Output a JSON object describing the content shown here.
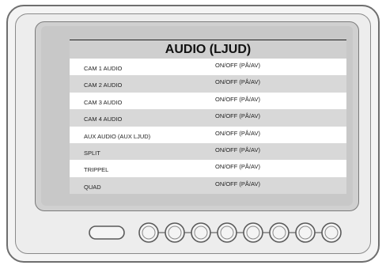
{
  "menu": {
    "title": "AUDIO (LJUD)",
    "rows": [
      {
        "label": "CAM 1 AUDIO",
        "value": "ON/OFF (PÅ/AV)"
      },
      {
        "label": "CAM 2 AUDIO",
        "value": "ON/OFF (PÅ/AV)"
      },
      {
        "label": "CAM 3 AUDIO",
        "value": "ON/OFF (PÅ/AV)"
      },
      {
        "label": "CAM 4 AUDIO",
        "value": "ON/OFF (PÅ/AV)"
      },
      {
        "label": "AUX AUDIO (AUX LJUD)",
        "value": "ON/OFF (PÅ/AV)"
      },
      {
        "label": "SPLIT",
        "value": "ON/OFF (PÅ/AV)"
      },
      {
        "label": "TRIPPEL",
        "value": "ON/OFF (PÅ/AV)"
      },
      {
        "label": "QUAD",
        "value": "ON/OFF (PÅ/AV)"
      }
    ]
  },
  "hardware": {
    "buttons": [
      "power-button",
      "round-button",
      "round-button",
      "round-button",
      "round-button",
      "round-button",
      "round-button",
      "round-button"
    ]
  }
}
